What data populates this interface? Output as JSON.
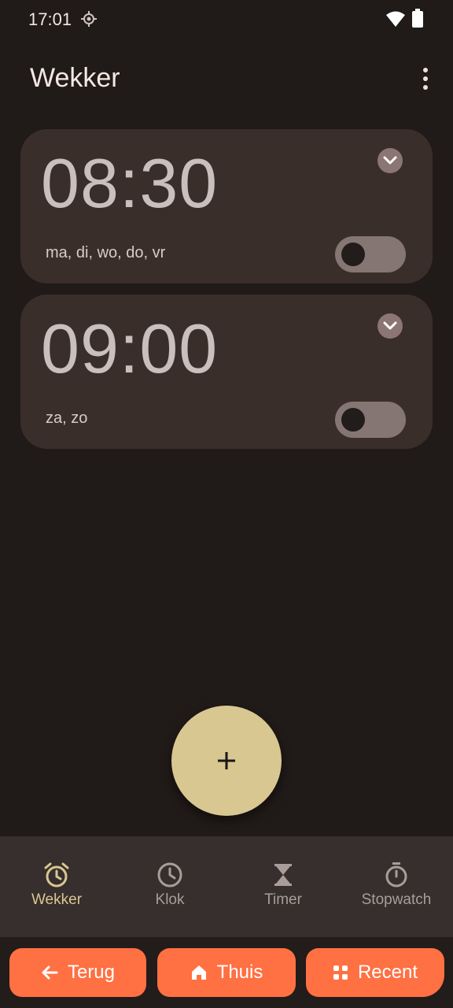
{
  "status_bar": {
    "time": "17:01"
  },
  "app_bar": {
    "title": "Wekker"
  },
  "alarms": [
    {
      "time": "08:30",
      "days": "ma, di, wo, do, vr",
      "enabled": false
    },
    {
      "time": "09:00",
      "days": "za, zo",
      "enabled": false
    }
  ],
  "fab": {
    "icon": "plus-icon"
  },
  "bottom_nav": {
    "items": [
      {
        "label": "Wekker",
        "icon": "alarm-icon",
        "active": true
      },
      {
        "label": "Klok",
        "icon": "clock-icon",
        "active": false
      },
      {
        "label": "Timer",
        "icon": "hourglass-icon",
        "active": false
      },
      {
        "label": "Stopwatch",
        "icon": "stopwatch-icon",
        "active": false
      }
    ]
  },
  "system_nav": {
    "back_label": "Terug",
    "home_label": "Thuis",
    "recent_label": "Recent"
  },
  "colors": {
    "background": "#201a18",
    "card": "#3a2e2b",
    "accent": "#d9c791",
    "system_button": "#ff7043"
  }
}
